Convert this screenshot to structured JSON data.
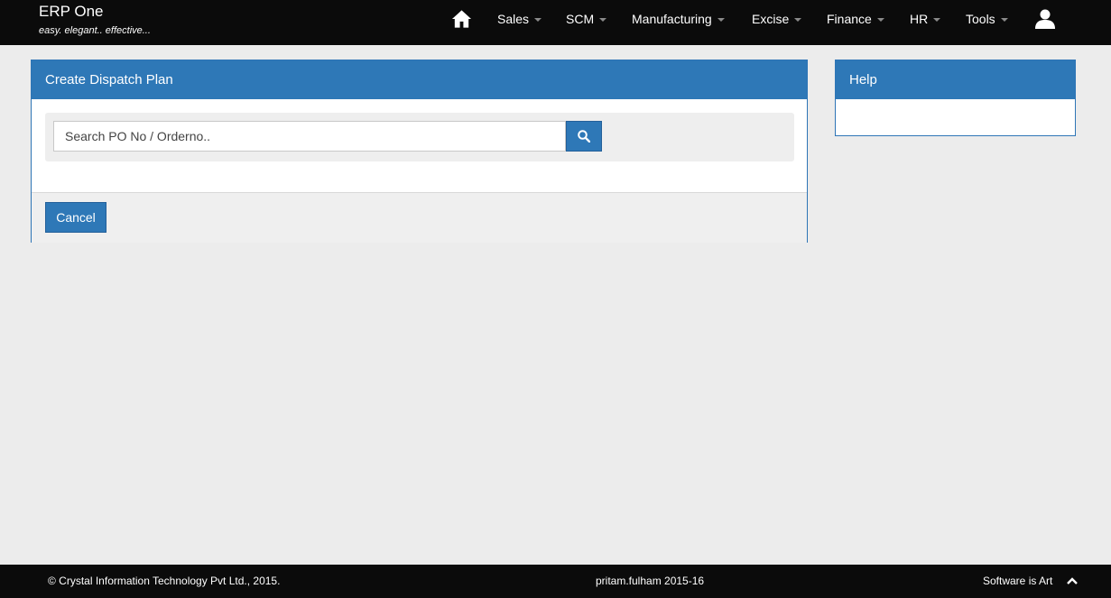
{
  "app": {
    "title": "ERP One",
    "tagline": "easy. elegant.. effective..."
  },
  "nav": {
    "home_icon": "home-icon",
    "items": [
      {
        "label": "Sales"
      },
      {
        "label": "SCM"
      },
      {
        "label": "Manufacturing"
      },
      {
        "label": "Excise"
      },
      {
        "label": "Finance"
      },
      {
        "label": "HR"
      },
      {
        "label": "Tools"
      }
    ],
    "user_icon": "user-icon"
  },
  "main": {
    "title": "Create Dispatch Plan",
    "search": {
      "placeholder": "Search PO No / Orderno..",
      "value": "",
      "button_icon": "search-icon"
    },
    "cancel_label": "Cancel"
  },
  "help": {
    "title": "Help"
  },
  "footer": {
    "copyright": "© Crystal Information Technology Pvt Ltd., 2015.",
    "session": "pritam.fulham 2015-16",
    "motto": "Software is Art",
    "scroll_icon": "chevron-up-icon"
  },
  "colors": {
    "navbar_bg": "#0b0b0b",
    "accent": "#2e78b7",
    "page_bg": "#ececec"
  }
}
